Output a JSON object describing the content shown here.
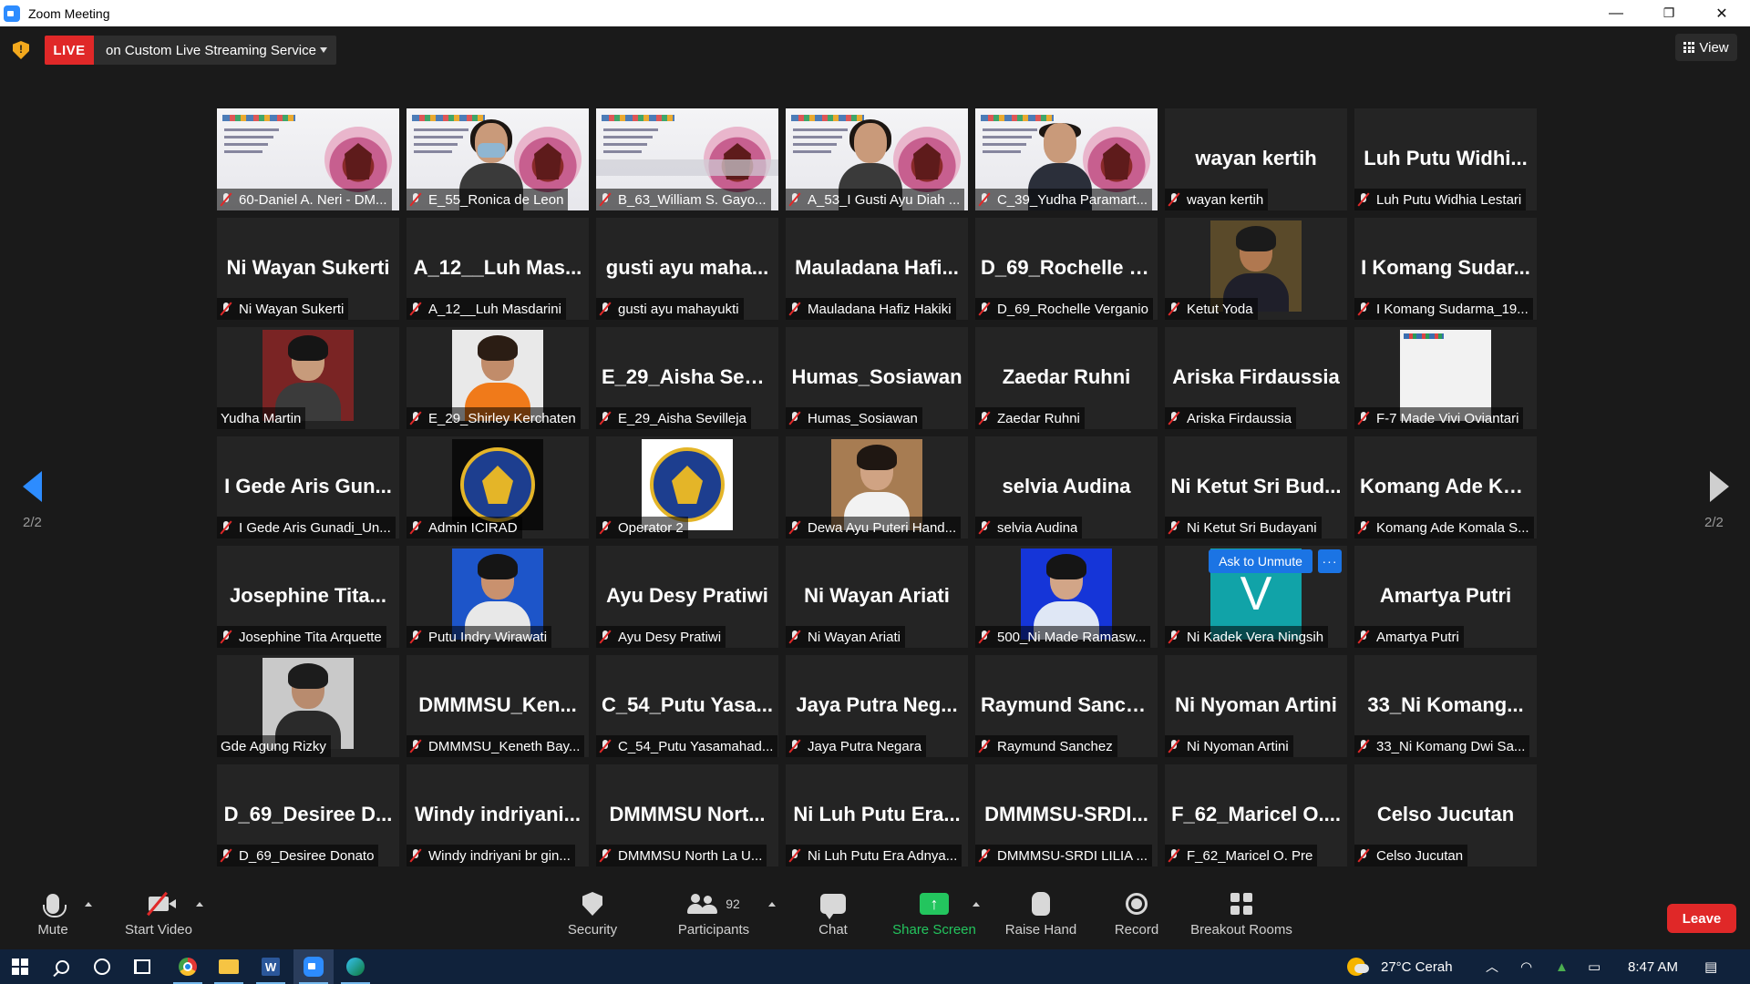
{
  "window": {
    "title": "Zoom Meeting",
    "controls": [
      "—",
      "❐",
      "✕"
    ]
  },
  "topbar": {
    "live_label": "LIVE",
    "live_service": "on Custom Live Streaming Service",
    "view_label": "View"
  },
  "pager": {
    "left_indicator": "2/2",
    "right_indicator": "2/2"
  },
  "tiles": [
    {
      "label": "60-Daniel A. Neri - DM...",
      "video": "slide"
    },
    {
      "label": "E_55_Ronica de Leon",
      "video": "slide-mask"
    },
    {
      "label": "B_63_William S. Gayo...",
      "video": "slide-plain"
    },
    {
      "label": "A_53_I Gusti Ayu Diah ...",
      "video": "slide-girl"
    },
    {
      "label": "C_39_Yudha Paramart...",
      "video": "slide-man"
    },
    {
      "big": "wayan kertih",
      "label": "wayan kertih"
    },
    {
      "big": "Luh Putu Widhi...",
      "label": "Luh Putu Widhia Lestari"
    },
    {
      "big": "Ni Wayan Sukerti",
      "label": "Ni Wayan Sukerti"
    },
    {
      "big": "A_12__Luh Mas...",
      "label": "A_12__Luh Masdarini"
    },
    {
      "big": "gusti ayu maha...",
      "label": "gusti ayu mahayukti"
    },
    {
      "big": "Mauladana Hafi...",
      "label": "Mauladana Hafiz Hakiki"
    },
    {
      "big": "D_69_Rochelle V...",
      "label": "D_69_Rochelle Verganio"
    },
    {
      "label": "Ketut Yoda",
      "video": "photo-man-suit"
    },
    {
      "big": "I Komang Sudar...",
      "label": "I Komang Sudarma_19..."
    },
    {
      "label": "Yudha Martin",
      "video": "photo-man-batik",
      "unmuted": true
    },
    {
      "label": "E_29_Shirley Kerchaten",
      "video": "photo-woman-orange"
    },
    {
      "big": "E_29_Aisha Sevil...",
      "label": "E_29_Aisha Sevilleja"
    },
    {
      "big": "Humas_Sosiawan",
      "label": "Humas_Sosiawan"
    },
    {
      "big": "Zaedar Ruhni",
      "label": "Zaedar Ruhni"
    },
    {
      "big": "Ariska Firdaussia",
      "label": "Ariska Firdaussia"
    },
    {
      "label": "F-7 Made Vivi Oviantari",
      "video": "slide-small"
    },
    {
      "big": "I Gede Aris Gun...",
      "label": "I Gede Aris Gunadi_Un..."
    },
    {
      "label": "Admin ICIRAD",
      "video": "logo-dark"
    },
    {
      "label": "Operator 2",
      "video": "logo-light"
    },
    {
      "label": "Dewa Ayu Puteri Hand...",
      "video": "photo-woman-white"
    },
    {
      "big": "selvia Audina",
      "label": "selvia Audina"
    },
    {
      "big": "Ni Ketut Sri Bud...",
      "label": "Ni Ketut Sri Budayani"
    },
    {
      "big": "Komang Ade Ko...",
      "label": "Komang Ade Komala S..."
    },
    {
      "big": "Josephine Tita...",
      "label": "Josephine Tita Arquette"
    },
    {
      "label": "Putu Indry Wirawati",
      "video": "photo-woman-blue"
    },
    {
      "big": "Ayu Desy Pratiwi",
      "label": "Ayu Desy Pratiwi"
    },
    {
      "big": "Ni Wayan Ariati",
      "label": "Ni Wayan Ariati"
    },
    {
      "label": "500_Ni Made Ramasw...",
      "video": "photo-woman-bluebg"
    },
    {
      "label": "Ni Kadek Vera Ningsih",
      "video": "v-avatar",
      "avatar_letter": "V"
    },
    {
      "big": "Amartya Putri",
      "label": "Amartya Putri"
    },
    {
      "label": "Gde Agung Rizky",
      "video": "photo-man-hoodie",
      "unmuted": true
    },
    {
      "big": "DMMMSU_Ken...",
      "label": "DMMMSU_Keneth Bay..."
    },
    {
      "big": "C_54_Putu Yasa...",
      "label": "C_54_Putu Yasamahad..."
    },
    {
      "big": "Jaya Putra Neg...",
      "label": "Jaya Putra Negara"
    },
    {
      "big": "Raymund Sanch...",
      "label": "Raymund Sanchez"
    },
    {
      "big": "Ni Nyoman Artini",
      "label": "Ni Nyoman Artini"
    },
    {
      "big": "33_Ni Komang...",
      "label": "33_Ni Komang Dwi Sa..."
    },
    {
      "big": "D_69_Desiree D...",
      "label": "D_69_Desiree Donato"
    },
    {
      "big": "Windy indriyani...",
      "label": "Windy indriyani br gin..."
    },
    {
      "big": "DMMMSU Nort...",
      "label": "DMMMSU North La U..."
    },
    {
      "big": "Ni Luh Putu Era...",
      "label": "Ni Luh Putu Era Adnya..."
    },
    {
      "big": "DMMMSU-SRDI...",
      "label": "DMMMSU-SRDI LILIA ..."
    },
    {
      "big": "F_62_Maricel O....",
      "label": "F_62_Maricel O. Pre"
    },
    {
      "big": "Celso Jucutan",
      "label": "Celso Jucutan"
    }
  ],
  "hover_actions": {
    "ask_to_unmute": "Ask to Unmute",
    "more": "···"
  },
  "toolbar": {
    "mute": "Mute",
    "start_video": "Start Video",
    "security": "Security",
    "participants": "Participants",
    "participants_count": "92",
    "chat": "Chat",
    "share_screen": "Share Screen",
    "raise_hand": "Raise Hand",
    "record": "Record",
    "breakout_rooms": "Breakout Rooms",
    "leave": "Leave",
    "share_color": "#23c55e",
    "leave_color": "#e02828"
  },
  "taskbar": {
    "weather": "27°C Cerah",
    "time": "8:47 AM",
    "word_letter": "W"
  }
}
